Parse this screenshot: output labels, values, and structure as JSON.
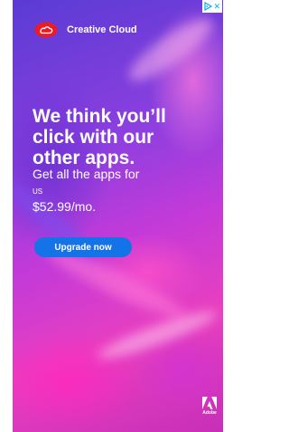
{
  "brand": {
    "name": "Creative Cloud",
    "icon": "creative-cloud-logo-icon"
  },
  "headline": {
    "lines": [
      "We think you’ll",
      "click with our",
      "other apps."
    ]
  },
  "subline": {
    "line1": "Get all the apps for",
    "currency": "US",
    "price": "$52.99/mo."
  },
  "cta": {
    "label": "Upgrade now"
  },
  "footer": {
    "brand": "Adobe",
    "icon": "adobe-logo-icon"
  },
  "adchoices": {
    "icons": [
      "adchoices-icon",
      "close-icon"
    ]
  },
  "colors": {
    "cta": "#1473e6",
    "logo_red": "#ed1c24",
    "text": "#ffffff",
    "adchoices": "#00aeef"
  }
}
